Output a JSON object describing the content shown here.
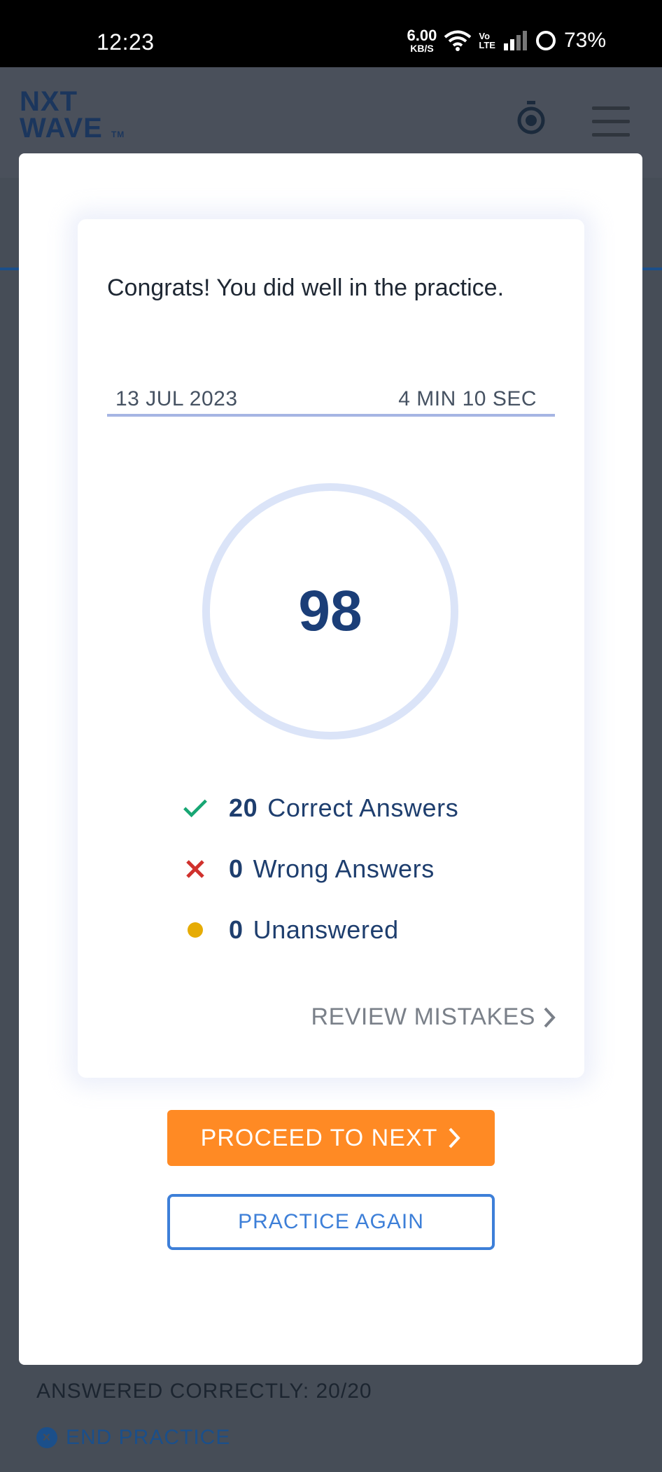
{
  "status_bar": {
    "time": "12:23",
    "net_speed_value": "6.00",
    "net_speed_unit": "KB/S",
    "volte_top": "Vo",
    "volte_bottom": "LTE",
    "battery": "73%"
  },
  "app": {
    "logo_line1": "NXT",
    "logo_line2": "WAVE",
    "logo_tm": "TM",
    "footer_progress": "ANSWERED CORRECTLY: 20/20",
    "end_practice": "END PRACTICE"
  },
  "result": {
    "message": "Congrats! You did well in the practice.",
    "date": "13 JUL 2023",
    "duration": "4 MIN 10 SEC",
    "score": "98",
    "stats": [
      {
        "count": "20",
        "label": "Correct Answers"
      },
      {
        "count": "0",
        "label": "Wrong Answers"
      },
      {
        "count": "0",
        "label": "Unanswered"
      }
    ],
    "review_label": "REVIEW MISTAKES",
    "proceed_label": "PROCEED TO NEXT",
    "practice_again_label": "PRACTICE AGAIN"
  },
  "colors": {
    "primary": "#1b3e78",
    "accent_orange": "#ff8a24",
    "link_blue": "#3d7fd8",
    "correct": "#17a673",
    "wrong": "#d0312d",
    "unanswered": "#e6ac05"
  },
  "icons": {
    "timer": "stopwatch-icon",
    "menu": "hamburger-menu-icon",
    "correct": "checkmark-icon",
    "wrong": "cross-icon",
    "unanswered": "dot-icon",
    "chevron": "chevron-right-icon"
  }
}
